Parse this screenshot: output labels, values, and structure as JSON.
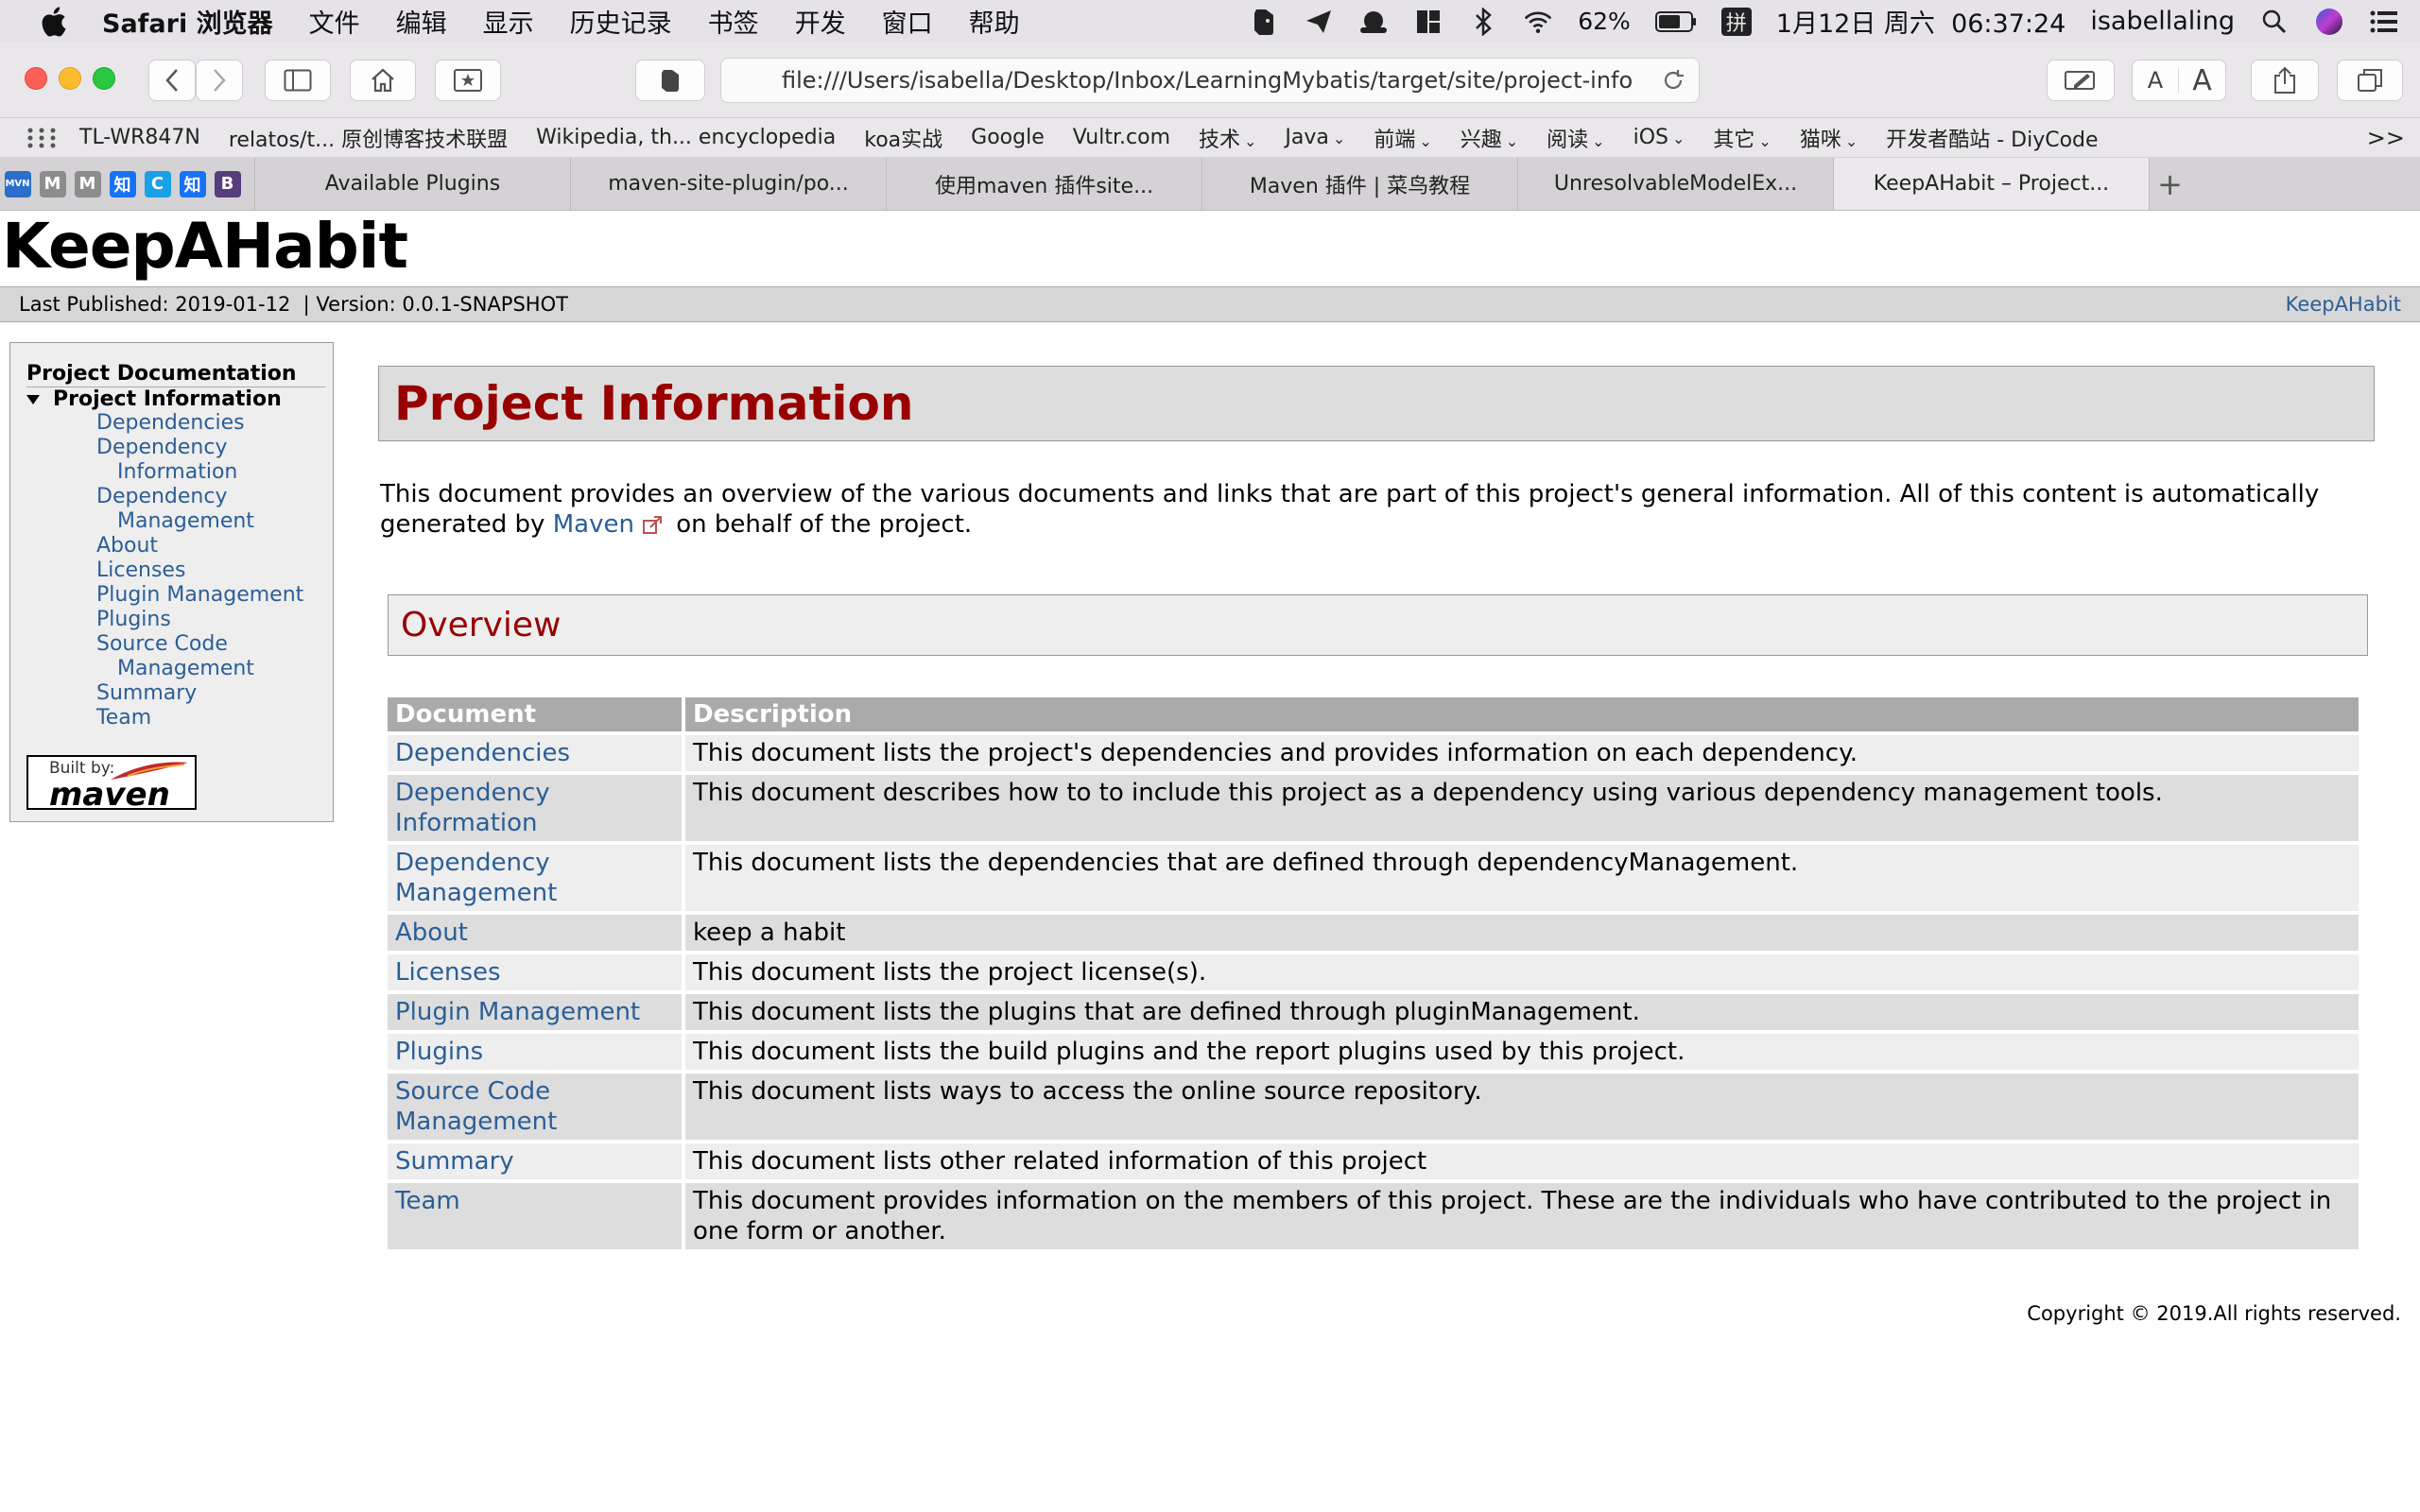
{
  "menubar": {
    "app_name": "Safari 浏览器",
    "items": [
      "文件",
      "编辑",
      "显示",
      "历史记录",
      "书签",
      "开发",
      "窗口",
      "帮助"
    ],
    "status": {
      "battery": "62%",
      "input_method": "拼",
      "datetime": "1月12日 周六  06:37:24",
      "user": "isabellaling"
    }
  },
  "toolbar": {
    "url": "file:///Users/isabella/Desktop/Inbox/LearningMybatis/target/site/project-info.html",
    "text_small": "A",
    "text_large": "A"
  },
  "bookmarks": [
    {
      "label": "TL-WR847N"
    },
    {
      "label": "relatos/t... 原创博客技术联盟"
    },
    {
      "label": "Wikipedia, th... encyclopedia"
    },
    {
      "label": "koa实战"
    },
    {
      "label": "Google"
    },
    {
      "label": "Vultr.com"
    },
    {
      "label": "技术",
      "folder": true
    },
    {
      "label": "Java",
      "folder": true
    },
    {
      "label": "前端",
      "folder": true
    },
    {
      "label": "兴趣",
      "folder": true
    },
    {
      "label": "阅读",
      "folder": true
    },
    {
      "label": "iOS",
      "folder": true
    },
    {
      "label": "其它",
      "folder": true
    },
    {
      "label": "猫咪",
      "folder": true
    },
    {
      "label": "开发者酷站 - DiyCode"
    }
  ],
  "bookmarks_more": ">>",
  "pinned_tabs": [
    {
      "glyph": "MVN",
      "color": "#2a6fc9"
    },
    {
      "glyph": "M",
      "color": "#8d8d8d"
    },
    {
      "glyph": "M",
      "color": "#8d8d8d"
    },
    {
      "glyph": "知",
      "color": "#1772f6"
    },
    {
      "glyph": "C",
      "color": "#1aa0e6"
    },
    {
      "glyph": "知",
      "color": "#1772f6"
    },
    {
      "glyph": "B",
      "color": "#563d7c"
    }
  ],
  "tabs": [
    {
      "title": "Available Plugins",
      "active": false
    },
    {
      "title": "maven-site-plugin/po...",
      "active": false
    },
    {
      "title": "使用maven 插件site...",
      "active": false
    },
    {
      "title": "Maven 插件 | 菜鸟教程",
      "active": false
    },
    {
      "title": "UnresolvableModelEx...",
      "active": false
    },
    {
      "title": "KeepAHabit – Project...",
      "active": true
    }
  ],
  "page": {
    "site_title": "KeepAHabit",
    "published": "Last Published: 2019-01-12  | Version: 0.0.1-SNAPSHOT",
    "brand_link": "KeepAHabit",
    "nav": {
      "heading": "Project Documentation",
      "current": "Project Information",
      "items": [
        "Dependencies",
        "Dependency Information",
        "Dependency Management",
        "About",
        "Licenses",
        "Plugin Management",
        "Plugins",
        "Source Code Management",
        "Summary",
        "Team"
      ]
    },
    "built_by_label": "Built by:",
    "built_by_logo": "maven",
    "heading": "Project Information",
    "intro_before": "This document provides an overview of the various documents and links that are part of this project's general information. All of this content is automatically generated by ",
    "intro_link": "Maven",
    "intro_after": " on behalf of the project.",
    "overview_heading": "Overview",
    "table": {
      "headers": [
        "Document",
        "Description"
      ],
      "rows": [
        {
          "doc": "Dependencies",
          "desc": "This document lists the project's dependencies and provides information on each dependency."
        },
        {
          "doc": "Dependency Information",
          "desc": "This document describes how to to include this project as a dependency using various dependency management tools."
        },
        {
          "doc": "Dependency Management",
          "desc": "This document lists the dependencies that are defined through dependencyManagement."
        },
        {
          "doc": "About",
          "desc": "keep a habit"
        },
        {
          "doc": "Licenses",
          "desc": "This document lists the project license(s)."
        },
        {
          "doc": "Plugin Management",
          "desc": "This document lists the plugins that are defined through pluginManagement."
        },
        {
          "doc": "Plugins",
          "desc": "This document lists the build plugins and the report plugins used by this project."
        },
        {
          "doc": "Source Code Management",
          "desc": "This document lists ways to access the online source repository."
        },
        {
          "doc": "Summary",
          "desc": "This document lists other related information of this project"
        },
        {
          "doc": "Team",
          "desc": "This document provides information on the members of this project. These are the individuals who have contributed to the project in one form or another."
        }
      ]
    },
    "copyright": "Copyright © 2019.All rights reserved."
  },
  "colors": {
    "link": "#2b5e96",
    "heading": "#990000",
    "table_header": "#aaaaaa"
  }
}
